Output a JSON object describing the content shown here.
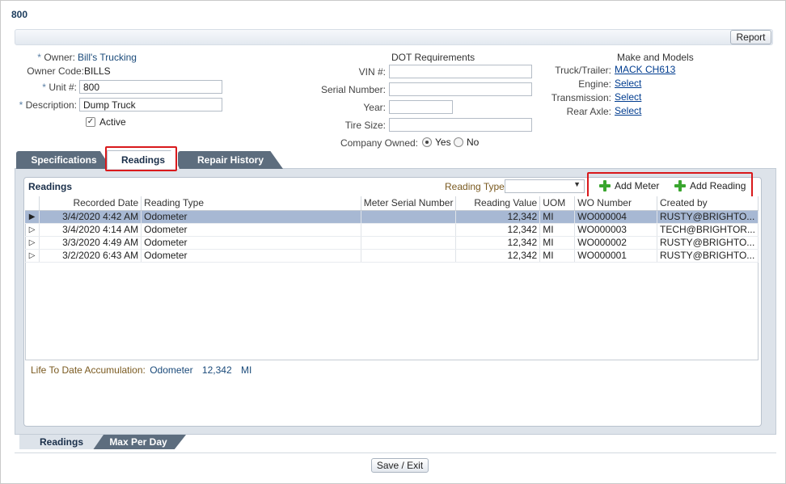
{
  "window": {
    "title": "800"
  },
  "toolbar": {
    "report_label": "Report"
  },
  "form": {
    "owner_label": "Owner:",
    "owner_value": "Bill's Trucking",
    "owner_code_label": "Owner Code:",
    "owner_code_value": "BILLS",
    "unit_label": "Unit #:",
    "unit_value": "800",
    "description_label": "Description:",
    "description_value": "Dump Truck",
    "active_label": "Active",
    "required_mark": "*"
  },
  "dot": {
    "heading": "DOT Requirements",
    "vin_label": "VIN #:",
    "vin_value": "",
    "serial_label": "Serial Number:",
    "serial_value": "",
    "year_label": "Year:",
    "year_value": "",
    "tire_label": "Tire Size:",
    "tire_value": "",
    "company_owned_label": "Company Owned:",
    "yes_label": "Yes",
    "no_label": "No"
  },
  "make_models": {
    "heading": "Make and Models",
    "truck_label": "Truck/Trailer:",
    "truck_value": "MACK CH613",
    "engine_label": "Engine:",
    "engine_value": "Select",
    "transmission_label": "Transmission:",
    "transmission_value": "Select",
    "rear_axle_label": "Rear Axle:",
    "rear_axle_value": "Select"
  },
  "tabs": [
    {
      "label": "Specifications"
    },
    {
      "label": "Readings"
    },
    {
      "label": "Repair History"
    }
  ],
  "readings": {
    "title": "Readings",
    "reading_type_label": "Reading Type",
    "reading_type_value": "",
    "add_meter_label": "Add Meter",
    "add_reading_label": "Add Reading",
    "columns": [
      "Recorded Date",
      "Reading Type",
      "Meter Serial Number",
      "Reading Value",
      "UOM",
      "WO Number",
      "Created by"
    ],
    "rows": [
      {
        "date": "3/4/2020 4:42 AM",
        "type": "Odometer",
        "serial": "",
        "value": "12,342",
        "uom": "MI",
        "wo": "WO000004",
        "created": "RUSTY@BRIGHTO..."
      },
      {
        "date": "3/4/2020 4:14 AM",
        "type": "Odometer",
        "serial": "",
        "value": "12,342",
        "uom": "MI",
        "wo": "WO000003",
        "created": "TECH@BRIGHTOR..."
      },
      {
        "date": "3/3/2020 4:49 AM",
        "type": "Odometer",
        "serial": "",
        "value": "12,342",
        "uom": "MI",
        "wo": "WO000002",
        "created": "RUSTY@BRIGHTO..."
      },
      {
        "date": "3/2/2020 6:43 AM",
        "type": "Odometer",
        "serial": "",
        "value": "12,342",
        "uom": "MI",
        "wo": "WO000001",
        "created": "RUSTY@BRIGHTO..."
      }
    ],
    "ltd_label": "Life To Date Accumulation:",
    "ltd_type": "Odometer",
    "ltd_value": "12,342",
    "ltd_uom": "MI"
  },
  "bottom_tabs": [
    {
      "label": "Readings"
    },
    {
      "label": "Max Per Day"
    }
  ],
  "footer": {
    "save_exit_label": "Save / Exit"
  },
  "colors": {
    "highlight": "#d9191c",
    "selected_row": "#a7b8d3",
    "tab_dark": "#5d6d7e",
    "add_icon": "#3aa62f"
  }
}
